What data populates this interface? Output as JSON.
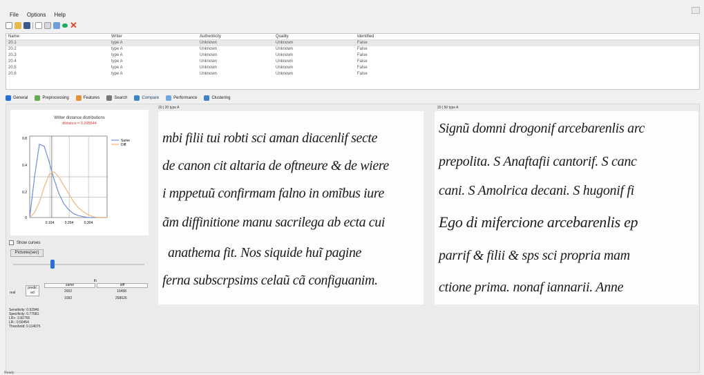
{
  "menu": {
    "file": "File",
    "options": "Options",
    "help": "Help"
  },
  "grid": {
    "columns": [
      "Name",
      "Writer",
      "Authenticity",
      "Quality",
      "Identified"
    ],
    "rows": [
      [
        "20.1",
        "type A",
        "Unknown",
        "Unknown",
        "False"
      ],
      [
        "20.2",
        "type A",
        "Unknown",
        "Unknown",
        "False"
      ],
      [
        "20.3",
        "type A",
        "Unknown",
        "Unknown",
        "False"
      ],
      [
        "20.4",
        "type A",
        "Unknown",
        "Unknown",
        "False"
      ],
      [
        "20.5",
        "type A",
        "Unknown",
        "Unknown",
        "False"
      ],
      [
        "20.6",
        "type A",
        "Unknown",
        "Unknown",
        "False"
      ]
    ]
  },
  "tabs": [
    {
      "label": "General",
      "color": "#2a6fd6"
    },
    {
      "label": "Preprocessing",
      "color": "#6aa84f"
    },
    {
      "label": "Features",
      "color": "#e69138"
    },
    {
      "label": "Search",
      "color": "#777777"
    },
    {
      "label": "Compare",
      "color": "#3d85c6"
    },
    {
      "label": "Performance",
      "color": "#6fa8dc"
    },
    {
      "label": "Clustering",
      "color": "#3d85c6"
    }
  ],
  "chart": {
    "title": "Writer distance distributions",
    "subtitle": "distance = 0.295544",
    "subtitle_color": "#e03030",
    "yticks": [
      "0.8",
      "0.4",
      "0.2",
      "0"
    ],
    "xticks": [
      "0.104",
      "0.204",
      "0.304"
    ],
    "legend": [
      {
        "name": "Same",
        "color": "#6a8fd8"
      },
      {
        "name": "Diff",
        "color": "#f2b27a"
      }
    ]
  },
  "chart_data": {
    "type": "line",
    "title": "Writer distance distributions",
    "subtitle": "distance = 0.295544",
    "x": [
      0.0,
      0.025,
      0.05,
      0.075,
      0.1,
      0.125,
      0.15,
      0.175,
      0.2,
      0.225,
      0.25,
      0.275,
      0.3,
      0.325,
      0.35,
      0.375,
      0.4
    ],
    "series": [
      {
        "name": "Same",
        "values": [
          0.0,
          0.4,
          0.72,
          0.7,
          0.55,
          0.38,
          0.24,
          0.14,
          0.08,
          0.04,
          0.02,
          0.01,
          0.0,
          0.0,
          0.0,
          0.0,
          0.0
        ]
      },
      {
        "name": "Diff",
        "values": [
          0.0,
          0.05,
          0.15,
          0.3,
          0.42,
          0.45,
          0.4,
          0.32,
          0.24,
          0.16,
          0.1,
          0.06,
          0.03,
          0.01,
          0.0,
          0.0,
          0.0
        ]
      }
    ],
    "yticks": [
      0,
      0.2,
      0.4,
      0.8
    ],
    "xticks": [
      0.104,
      0.204,
      0.304
    ],
    "ylim": [
      0,
      0.8
    ],
    "xlim": [
      0,
      0.4
    ],
    "threshold_x": 0.114,
    "grid": true,
    "legend_position": "top-right"
  },
  "left_panel": {
    "show_curves_label": "Show curves",
    "pictures_button": "Pictures(sec)",
    "slider_value": 0.3,
    "matrix": {
      "row_label": "real",
      "corner": [
        "predic",
        "ed"
      ],
      "header": "th",
      "col_labels": [
        "same",
        "diff"
      ],
      "r1": [
        "2002",
        "10458"
      ],
      "r2": [
        "1092",
        "258626"
      ]
    },
    "stats": [
      "Sensitivity: 0.62946",
      "Specificity: 0.77681",
      "LR+: 2.82755",
      "LR-: 0.50454",
      "Threshold: 0.114075"
    ]
  },
  "images": {
    "left_label": "20 | 20 type A",
    "right_label": "20 | 50 type A",
    "left_lines": [
      "mbi filii tui robti sci aman diacenlif secte",
      "de canon cit altaria de oftneure & de wiere",
      "i mppetuũ confirmam falno in omĩbus iure",
      "ãm diffinitione manu sacrilega ab ecta cui",
      "anathema fit. Nos siquide huĩ pagine",
      "ferna subscrpsims celaũ cã configuanim."
    ],
    "right_lines": [
      "Signũ domni drogonif arcebarenlis arc",
      "prepolita. S Anaftafii cantorif. S canc",
      "cani. S Amolrica decani. S hugonif fi",
      "Ego di mifercione arcebarenlis ep",
      "parrif & filii & sps sci propria mam",
      "ctione prima. nonaf iannarii. Anne"
    ]
  },
  "statusbar": "Ready"
}
